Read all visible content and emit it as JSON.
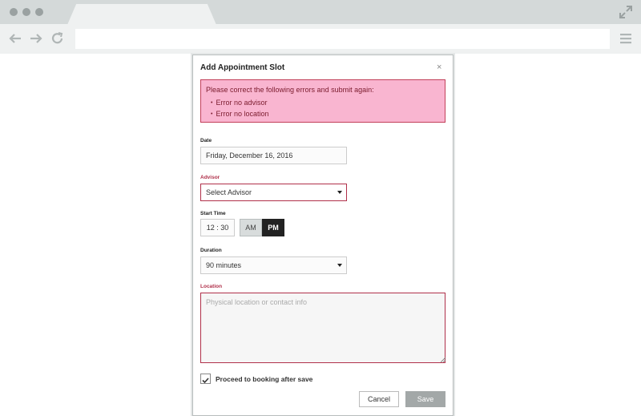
{
  "modal": {
    "title": "Add Appointment Slot",
    "close": "×"
  },
  "errors": {
    "heading": "Please correct the following errors and submit again:",
    "items": [
      "Error no advisor",
      "Error no location"
    ]
  },
  "date": {
    "label": "Date",
    "value": "Friday, December 16, 2016"
  },
  "advisor": {
    "label": "Advisor",
    "value": "Select Advisor"
  },
  "start_time": {
    "label": "Start Time",
    "value": "12 : 30",
    "am": "AM",
    "pm": "PM",
    "selected": "PM"
  },
  "duration": {
    "label": "Duration",
    "value": "90 minutes"
  },
  "location": {
    "label": "Location",
    "placeholder": "Physical location or contact info"
  },
  "proceed": {
    "label": "Proceed to booking after save",
    "checked": true
  },
  "buttons": {
    "cancel": "Cancel",
    "save": "Save"
  },
  "colors": {
    "error_bg": "#f9b5d0",
    "error_border": "#c2405a",
    "error_text": "#b0304a",
    "pm_active": "#222222",
    "save_disabled": "#a3a8a8",
    "chrome": "#d4d9d9"
  }
}
